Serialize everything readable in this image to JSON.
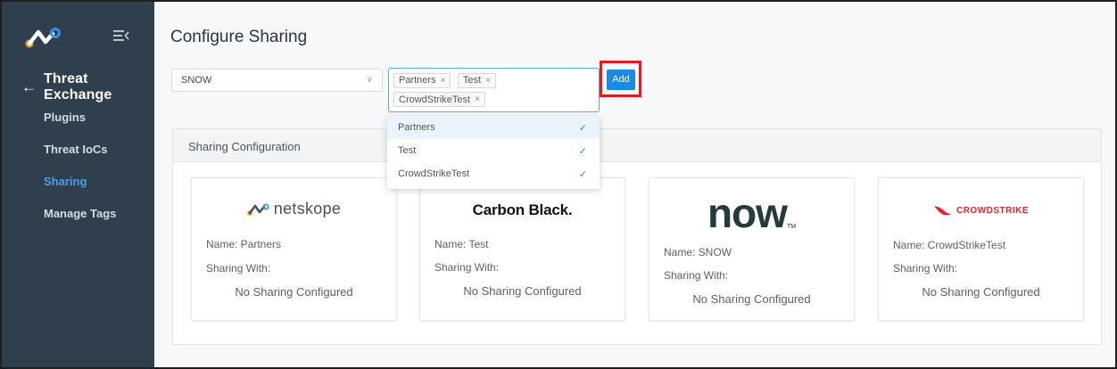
{
  "sidebar": {
    "back_label": "Threat Exchange",
    "items": [
      {
        "label": "Plugins",
        "active": false
      },
      {
        "label": "Threat IoCs",
        "active": false
      },
      {
        "label": "Sharing",
        "active": true
      },
      {
        "label": "Manage Tags",
        "active": false
      }
    ]
  },
  "page": {
    "title": "Configure Sharing"
  },
  "controls": {
    "source_select_value": "SNOW",
    "selected_tags": [
      "Partners",
      "Test",
      "CrowdStrikeTest"
    ],
    "add_label": "Add"
  },
  "dropdown": {
    "options": [
      {
        "label": "Partners",
        "checked": true,
        "highlighted": true
      },
      {
        "label": "Test",
        "checked": true,
        "highlighted": false
      },
      {
        "label": "CrowdStrikeTest",
        "checked": true,
        "highlighted": false
      }
    ]
  },
  "config": {
    "header": "Sharing Configuration",
    "cards": [
      {
        "logo_text": "netskope",
        "logo_icon": "netskope-logo-icon",
        "name_line": "Name: Partners",
        "sharing_label": "Sharing With:",
        "empty_text": "No Sharing Configured"
      },
      {
        "logo_text": "Carbon Black.",
        "name_line": "Name: Test",
        "sharing_label": "Sharing With:",
        "empty_text": "No Sharing Configured"
      },
      {
        "logo_text": "now",
        "logo_tm": "TM",
        "name_line": "Name: SNOW",
        "sharing_label": "Sharing With:",
        "empty_text": "No Sharing Configured"
      },
      {
        "logo_text": "CROWDSTRIKE",
        "logo_icon": "falcon-icon",
        "name_line": "Name: CrowdStrikeTest",
        "sharing_label": "Sharing With:",
        "empty_text": "No Sharing Configured"
      }
    ]
  },
  "colors": {
    "sidebar_bg": "#2f3f4d",
    "accent": "#1e88e5",
    "active_nav": "#4a9eea",
    "highlight_box": "#e01b22",
    "crowdstrike_red": "#e3262d"
  }
}
